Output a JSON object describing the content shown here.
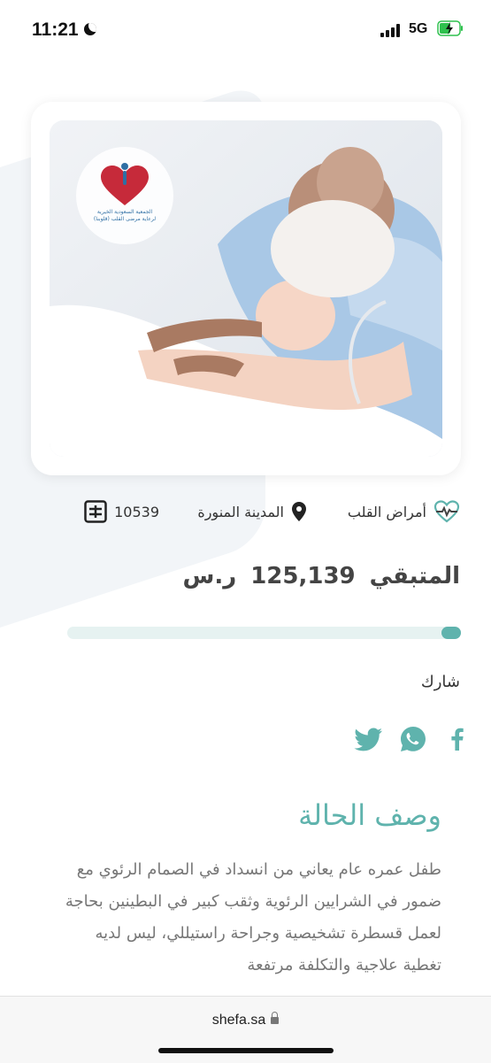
{
  "status": {
    "time": "11:21",
    "network": "5G"
  },
  "case": {
    "logo_text": "الجمعية السعودية الخيرية لرعاية مرضى القلب (قلوبنا)",
    "category": "أمراض القلب",
    "city": "المدينة المنورة",
    "case_id": "10539",
    "remaining_label": "المتبقي",
    "remaining_amount": "125,139",
    "currency": "ر.س",
    "progress_percent": 5
  },
  "share": {
    "label": "شارك",
    "icons": [
      "facebook-icon",
      "whatsapp-icon",
      "twitter-icon"
    ]
  },
  "description": {
    "title": "وصف الحالة",
    "text": "طفل عمره عام يعاني من انسداد في الصمام الرئوي مع ضمور في الشرايين الرئوية وثقب كبير في البطينين بحاجة لعمل قسطرة تشخيصية وجراحة راستيللي، ليس لديه تغطية علاجية والتكلفة مرتفعة"
  },
  "browser": {
    "url": "shefa.sa"
  },
  "colors": {
    "accent": "#5fb3ad",
    "track": "#e6f2f1"
  }
}
